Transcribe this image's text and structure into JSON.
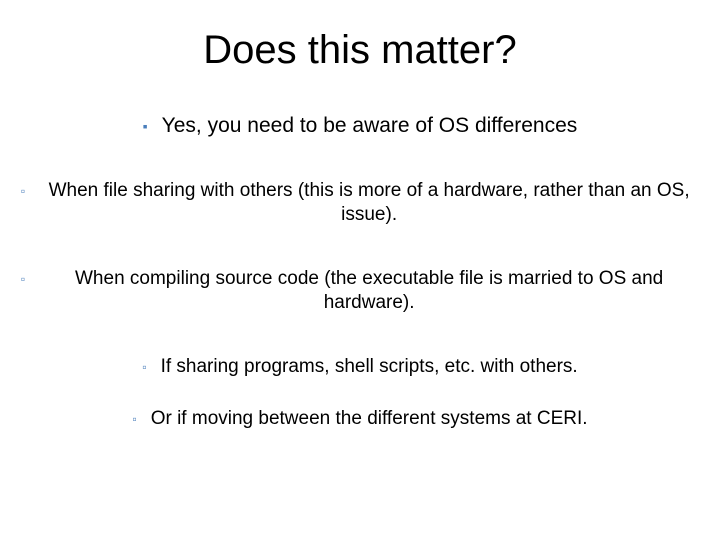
{
  "title": "Does this matter?",
  "bullets": {
    "b0": "Yes, you need to be aware of OS differences",
    "b1": "When file sharing with others (this is more of a hardware, rather than an OS, issue).",
    "b2": "When compiling source code (the executable file is married to OS and hardware).",
    "b3": "If sharing programs, shell scripts, etc. with others.",
    "b4": "Or if moving between the different systems at CERI."
  },
  "markers": {
    "solid": "▪",
    "hollow": "▫"
  }
}
